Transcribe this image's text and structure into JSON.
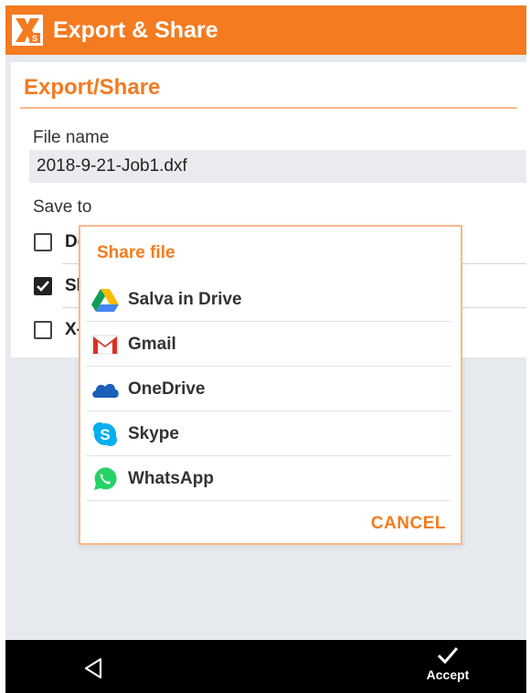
{
  "app_bar": {
    "title": "Export & Share",
    "logo_icon": "xpad-logo-icon",
    "color": "#f47b20"
  },
  "export_form": {
    "section_title": "Export/Share",
    "file_name_label": "File name",
    "file_name_value": "2018-9-21-Job1.dxf",
    "save_to_label": "Save to",
    "options": [
      {
        "label": "De",
        "checked": false
      },
      {
        "label": "Sh",
        "checked": true
      },
      {
        "label": "X-",
        "checked": false
      }
    ]
  },
  "share_dialog": {
    "title": "Share file",
    "items": [
      {
        "label": "Salva in Drive",
        "icon": "google-drive-icon"
      },
      {
        "label": "Gmail",
        "icon": "gmail-icon"
      },
      {
        "label": "OneDrive",
        "icon": "onedrive-icon"
      },
      {
        "label": "Skype",
        "icon": "skype-icon"
      },
      {
        "label": "WhatsApp",
        "icon": "whatsapp-icon"
      }
    ],
    "cancel_label": "CANCEL"
  },
  "bottom_bar": {
    "back_icon": "back-triangle-icon",
    "accept_icon": "checkmark-icon",
    "accept_label": "Accept"
  }
}
